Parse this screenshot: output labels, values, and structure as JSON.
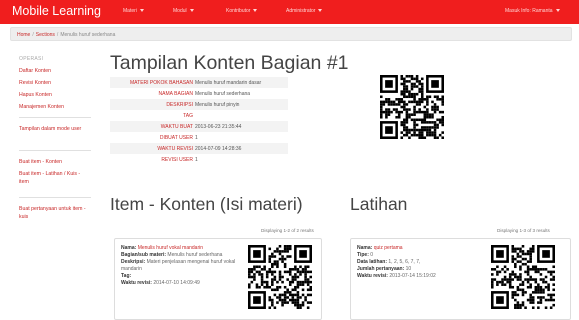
{
  "navbar": {
    "brand": "Mobile Learning",
    "menus": [
      "Materi",
      "Modul",
      "Kontributor",
      "Administrator"
    ],
    "user": "Masuk Info: Ramanta"
  },
  "breadcrumb": {
    "home": "Home",
    "sections": "Sections",
    "current": "Menulis huruf sederhana"
  },
  "sidebar": {
    "header": "OPERASI",
    "group1": [
      "Daftar Konten",
      "Revisi Konten",
      "Hapus Konten",
      "Manajemen Konten"
    ],
    "group2": [
      "Tampilan dalam mode user"
    ],
    "group3": [
      "Buat item - Konten",
      "Buat item - Latihan / Kuis - item"
    ],
    "group4": [
      "Buat pertanyaan untuk item - kuis"
    ]
  },
  "main": {
    "title": "Tampilan Konten Bagian #1",
    "details": [
      {
        "label": "MATERI POKOK BAHASAN",
        "value": "Menulis huruf mandarin dasar"
      },
      {
        "label": "NAMA BAGIAN",
        "value": "Menulis huruf sederhana"
      },
      {
        "label": "DESKRIPSI",
        "value": "Menulis huruf pinyin"
      },
      {
        "label": "TAG",
        "value": ""
      },
      {
        "label": "WAKTU BUAT",
        "value": "2013-06-23 21:35:44"
      },
      {
        "label": "DIBUAT USER",
        "value": "1"
      },
      {
        "label": "WAKTU REVISI",
        "value": "2014-07-09 14:28:36"
      },
      {
        "label": "REVISI USER",
        "value": "1"
      }
    ]
  },
  "konten": {
    "title": "Item - Konten (Isi materi)",
    "summary": "Displaying 1-2 of 2 results",
    "card": {
      "nama_label": "Nama:",
      "nama": "Menulis huruf vokal mandarin",
      "bagian_label": "Bagian/sub materi:",
      "bagian": "Menulis huruf sederhana",
      "deskripsi_label": "Deskripsi:",
      "deskripsi": "Materi penjelasan mengenai huruf vokal mandarin",
      "tag_label": "Tag:",
      "tag": "",
      "waktu_label": "Waktu revisi:",
      "waktu": "2014-07-10 14:09:49"
    }
  },
  "latihan": {
    "title": "Latihan",
    "summary": "Displaying 1-3 of 3 results",
    "card": {
      "nama_label": "Nama:",
      "nama": "quiz pertama",
      "tipe_label": "Tipe:",
      "tipe": "0",
      "data_label": "Data latihan:",
      "data": "1, 2, 5, 6, 7, 7,",
      "jumlah_label": "Jumlah pertanyaan:",
      "jumlah": "10",
      "waktu_label": "Waktu revisi:",
      "waktu": "2013-07-14 15:19:02"
    }
  },
  "colors": {
    "navbar": "#f01e1e",
    "link": "#c82828",
    "title": "#444444"
  },
  "icons": [
    "caret-down-icon",
    "qr-code-icon"
  ]
}
